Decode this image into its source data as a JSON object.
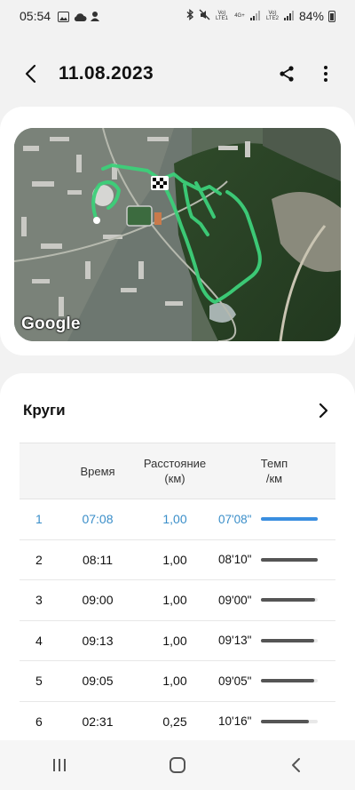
{
  "status": {
    "time": "05:54",
    "net1": "Vo) LTE1",
    "net1_type": "4G+",
    "net2": "Vo) LTE2",
    "battery": "84%"
  },
  "header": {
    "title": "11.08.2023"
  },
  "map": {
    "attribution": "Google",
    "route_color": "#3dd07a"
  },
  "laps": {
    "title": "Круги",
    "columns": {
      "time": "Время",
      "distance_line1": "Расстояние",
      "distance_line2": "(км)",
      "pace_line1": "Темп",
      "pace_line2": "/км"
    },
    "rows": [
      {
        "num": "1",
        "time": "07:08",
        "distance": "1,00",
        "pace": "07'08\"",
        "pace_level": 1.0
      },
      {
        "num": "2",
        "time": "08:11",
        "distance": "1,00",
        "pace": "08'10\"",
        "pace_level": 1.0
      },
      {
        "num": "3",
        "time": "09:00",
        "distance": "1,00",
        "pace": "09'00\"",
        "pace_level": 0.95
      },
      {
        "num": "4",
        "time": "09:13",
        "distance": "1,00",
        "pace": "09'13\"",
        "pace_level": 0.94
      },
      {
        "num": "5",
        "time": "09:05",
        "distance": "1,00",
        "pace": "09'05\"",
        "pace_level": 0.94
      },
      {
        "num": "6",
        "time": "02:31",
        "distance": "0,25",
        "pace": "10'16\"",
        "pace_level": 0.84
      }
    ],
    "highlight_color": "#3a8ec9"
  }
}
